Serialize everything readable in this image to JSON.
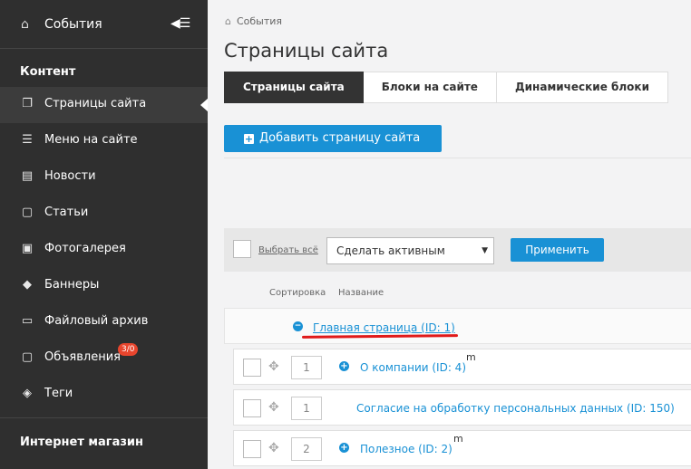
{
  "sidebar": {
    "top_title": "События",
    "sections": {
      "content": "Контент",
      "shop": "Интернет магазин"
    },
    "items": [
      {
        "label": "Страницы сайта"
      },
      {
        "label": "Меню на сайте"
      },
      {
        "label": "Новости"
      },
      {
        "label": "Статьи"
      },
      {
        "label": "Фотогалерея"
      },
      {
        "label": "Баннеры"
      },
      {
        "label": "Файловый архив"
      },
      {
        "label": "Объявления",
        "badge": "3/0"
      },
      {
        "label": "Теги"
      }
    ]
  },
  "breadcrumb": {
    "current": "События"
  },
  "page_title": "Страницы сайта",
  "tabs": [
    {
      "label": "Страницы сайта",
      "active": true
    },
    {
      "label": "Блоки на сайте",
      "active": false
    },
    {
      "label": "Динамические блоки",
      "active": false
    }
  ],
  "add_button": "Добавить страницу сайта",
  "toolbar": {
    "select_all": "Выбрать всё",
    "action_selected": "Сделать активным",
    "apply": "Применить"
  },
  "columns": {
    "sort": "Сортировка",
    "name": "Название"
  },
  "root": {
    "label": "Главная страница (ID: 1)"
  },
  "rows": [
    {
      "sort": "1",
      "label": "О компании (ID: 4)",
      "marker": "m"
    },
    {
      "sort": "1",
      "label": "Согласие на обработку персональных данных (ID: 150)"
    },
    {
      "sort": "2",
      "label": "Полезное (ID: 2)",
      "marker": "m"
    }
  ],
  "colors": {
    "accent": "#1991d5",
    "sidebar_bg": "#2f2f2f",
    "badge": "#e8452d",
    "annotation": "#e01a1a"
  }
}
